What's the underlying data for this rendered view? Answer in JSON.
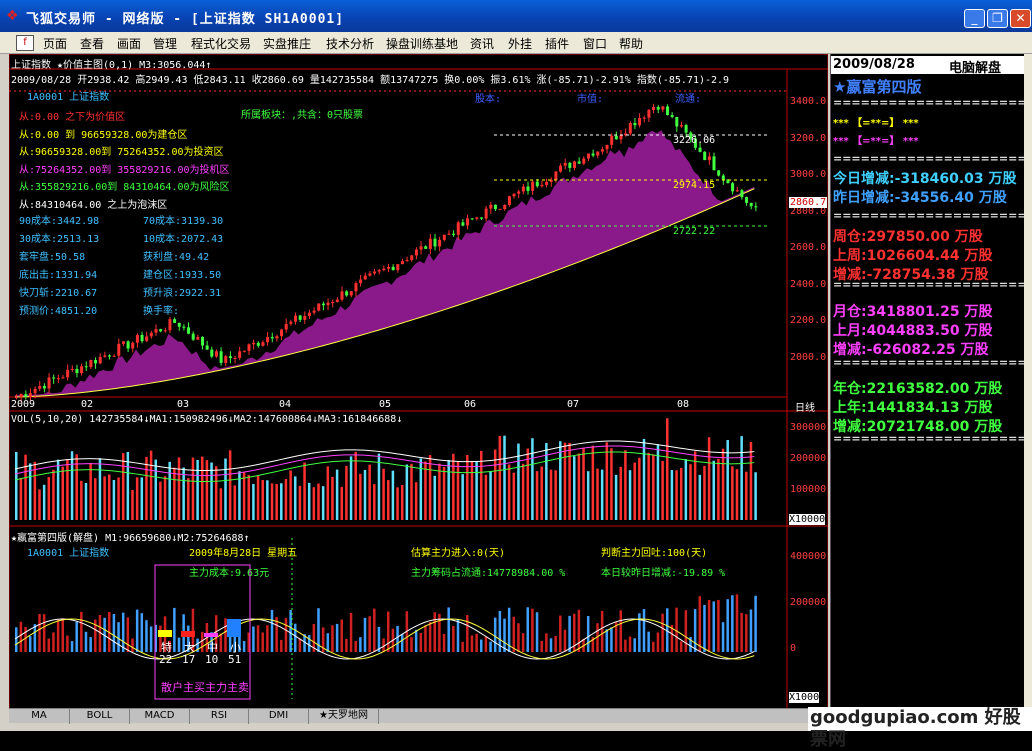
{
  "window": {
    "title": "飞狐交易师 - 网络版 - [上证指数 SH1A0001]",
    "logo_icon": "diamond-logo-icon",
    "controls": [
      "_",
      "❐",
      "✕"
    ]
  },
  "menu": [
    "页面",
    "查看",
    "画面",
    "管理",
    "程式化交易",
    "实盘推庄",
    "技术分析",
    "操盘训练基地",
    "资讯",
    "外挂",
    "插件",
    "窗口",
    "帮助"
  ],
  "top": {
    "line1": "上证指数 ★价值主图(0,1) M3:3056.044↑",
    "line2": "2009/08/28 开2938.42 高2949.43 低2843.11 收2860.69 量142735584 额13747275 换0.00% 振3.61% 涨(-85.71)-2.91% 指数(-85.71)-2.9",
    "code": "1A0001 上证指数",
    "sector": "所属板块：,共含：0只股票",
    "stock_capital": "股本:",
    "market_value": "市值:",
    "float": "流通:",
    "zones": [
      {
        "text": "从:0.00 之下为价值区",
        "color": "#ff3030"
      },
      {
        "text": "从:0.00       到 96659328.00为建仓区",
        "color": "#ffff00"
      },
      {
        "text": "从:96659328.00到 75264352.00为投资区",
        "color": "#ffff00"
      },
      {
        "text": "从:75264352.00到 355829216.00为投机区",
        "color": "#ff40ff"
      },
      {
        "text": "从:355829216.00到 84310464.00为风险区",
        "color": "#40ff40"
      },
      {
        "text": "从:84310464.00 之上为泡沫区",
        "color": "#ffffff"
      }
    ],
    "costs": [
      {
        "l": "90成本:3442.98",
        "r": "70成本:3139.30"
      },
      {
        "l": "30成本:2513.13",
        "r": "10成本:2072.43"
      },
      {
        "l": "套牢盘:50.58",
        "r": "获利盘:49.42"
      },
      {
        "l": "底出击:1331.94",
        "r": "建仓区:1933.50"
      },
      {
        "l": "快刀斩:2210.67",
        "r": "预升浪:2922.31"
      },
      {
        "l": "预测价:4851.20",
        "r": "换手率:"
      }
    ],
    "levels": [
      "3226.06",
      "2974.15",
      "2722.22"
    ],
    "price_axis": [
      "3400.0",
      "3200.0",
      "3000.0",
      "2800.0",
      "2600.0",
      "2400.0",
      "2200.0",
      "2000.0"
    ],
    "current_price": "2860.7",
    "months": [
      "2009",
      "02",
      "03",
      "04",
      "05",
      "06",
      "07",
      "08"
    ],
    "period": "日线"
  },
  "vol": {
    "header": "VOL(5,10,20) 142735584↓MA1:150982496↓MA2:147600864↓MA3:161846688↓",
    "axis": [
      "300000",
      "200000",
      "100000"
    ],
    "unit": "X10000"
  },
  "ind": {
    "header": "★嬴富第四版(解盘) M1:96659680↓M2:75264688↑",
    "code": "1A0001 上证指数",
    "date": "2009年8月28日 星期五",
    "inflow": "估算主力进入:0(天)",
    "judge": "判断主力回吐:100(天)",
    "cost": "主力成本:9.63元",
    "chips": "主力筹码占流通:14778984.00 %",
    "daily": "本日较昨日增减:-19.89 %",
    "bars": [
      {
        "l": "特",
        "v": "22",
        "c": "#ffff00"
      },
      {
        "l": "大",
        "v": "17",
        "c": "#ff2020"
      },
      {
        "l": "中",
        "v": "10",
        "c": "#ff40ff"
      },
      {
        "l": "小",
        "v": "51",
        "c": "#2080ff"
      }
    ],
    "caption": "散户主买主力主卖",
    "axis": [
      "400000",
      "200000",
      "0"
    ],
    "unit": "X1000"
  },
  "tabs": [
    "MA",
    "BOLL",
    "MACD",
    "RSI",
    "DMI",
    "★天罗地网"
  ],
  "panel": {
    "date": "2009/08/28",
    "title": "电脑解盘",
    "name": "★嬴富第四版",
    "sep": "=======================",
    "legend1": "*** 【=**=】 ***",
    "legend2": "*** 【=**=】 ***",
    "today": "今日增减:-318460.03 万股",
    "yesterday": "昨日增减:-34556.40 万股",
    "week": "周仓:297850.00 万股",
    "lastweek": "上周:1026604.44 万股",
    "weekdiff": "增减:-728754.38 万股",
    "month": "月仓:3418801.25 万股",
    "lastmonth": "上月:4044883.50 万股",
    "monthdiff": "增减:-626082.25 万股",
    "year": "年仓:22163582.00 万股",
    "lastyear": "上年:1441834.13 万股",
    "yeardiff": "增减:20721748.00 万股"
  },
  "watermark": "goodgupiao.com 好股票网"
}
